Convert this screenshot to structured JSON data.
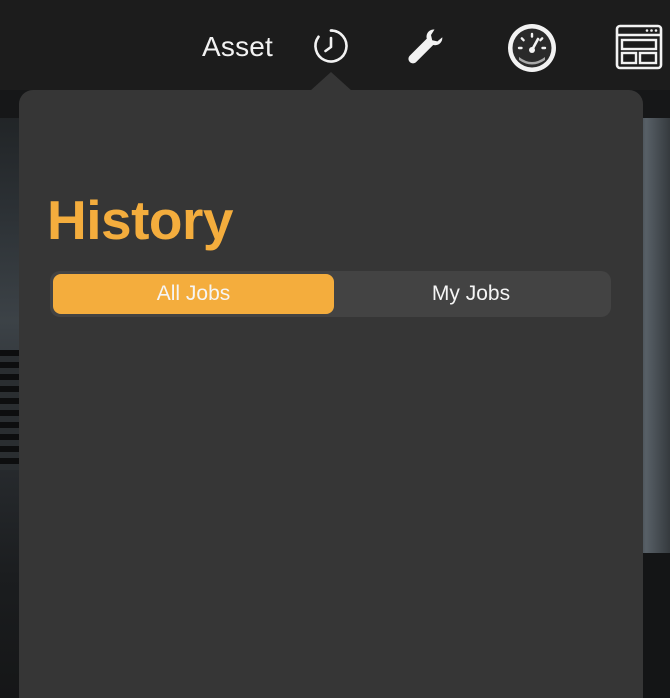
{
  "header": {
    "title": "Asset",
    "icons": [
      "history-clock-icon",
      "wrench-icon",
      "gauge-icon",
      "dashboard-layout-icon"
    ]
  },
  "popover": {
    "title": "History",
    "segments": [
      {
        "label": "All Jobs",
        "selected": true
      },
      {
        "label": "My Jobs",
        "selected": false
      }
    ]
  },
  "colors": {
    "accent": "#f4ad3d",
    "popover_bg": "#363636",
    "topbar_bg": "#1c1c1c",
    "segment_bg": "#434343",
    "text": "#f5f5f5"
  }
}
